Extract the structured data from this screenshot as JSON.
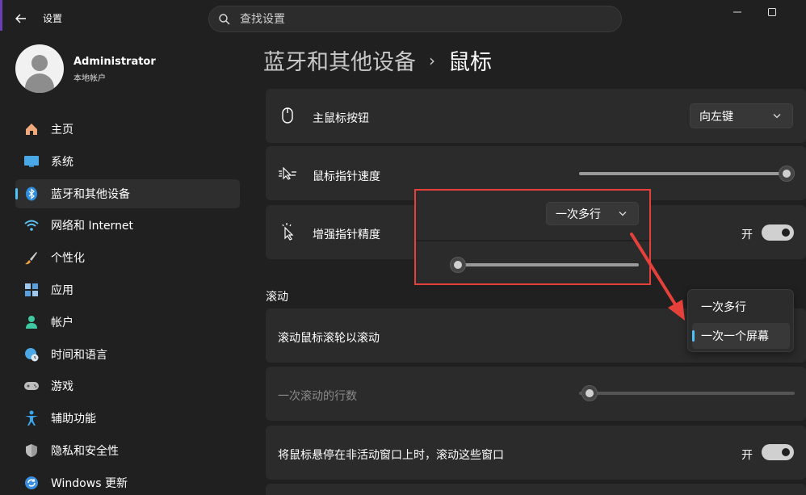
{
  "window": {
    "title": "设置",
    "search_placeholder": "查找设置"
  },
  "user": {
    "name": "Administrator",
    "account_type": "本地帐户"
  },
  "sidebar": {
    "items": [
      {
        "label": "主页",
        "icon": "home-icon"
      },
      {
        "label": "系统",
        "icon": "monitor-icon"
      },
      {
        "label": "蓝牙和其他设备",
        "icon": "bluetooth-icon",
        "active": true
      },
      {
        "label": "网络和 Internet",
        "icon": "wifi-icon"
      },
      {
        "label": "个性化",
        "icon": "brush-icon"
      },
      {
        "label": "应用",
        "icon": "apps-icon"
      },
      {
        "label": "帐户",
        "icon": "account-icon"
      },
      {
        "label": "时间和语言",
        "icon": "globe-clock-icon"
      },
      {
        "label": "游戏",
        "icon": "gamepad-icon"
      },
      {
        "label": "辅助功能",
        "icon": "accessibility-icon"
      },
      {
        "label": "隐私和安全性",
        "icon": "shield-icon"
      },
      {
        "label": "Windows 更新",
        "icon": "update-icon"
      }
    ]
  },
  "breadcrumb": {
    "parent": "蓝牙和其他设备",
    "separator": "›",
    "current": "鼠标"
  },
  "settings": {
    "primary_button": {
      "label": "主鼠标按钮",
      "value": "向左键"
    },
    "pointer_speed": {
      "label": "鼠标指针速度",
      "level": 1.0
    },
    "enhance_precision": {
      "label": "增强指针精度",
      "state_text": "开",
      "on": true
    },
    "scroll_section": "滚动",
    "wheel_scroll": {
      "label": "滚动鼠标滚轮以滚动"
    },
    "lines_to_scroll": {
      "label": "一次滚动的行数",
      "level": 0.0
    },
    "inactive_scroll": {
      "label": "将鼠标悬停在非活动窗口上时，滚动这些窗口",
      "state_text": "开",
      "on": true
    }
  },
  "annotation": {
    "dropdown_value": "一次多行",
    "slider_level": 0.0
  },
  "popup": {
    "options": [
      "一次多行",
      "一次一个屏幕"
    ],
    "selected_index": 1
  },
  "colors": {
    "accent": "#4fc3f7",
    "annotation_red": "#e5413a"
  }
}
